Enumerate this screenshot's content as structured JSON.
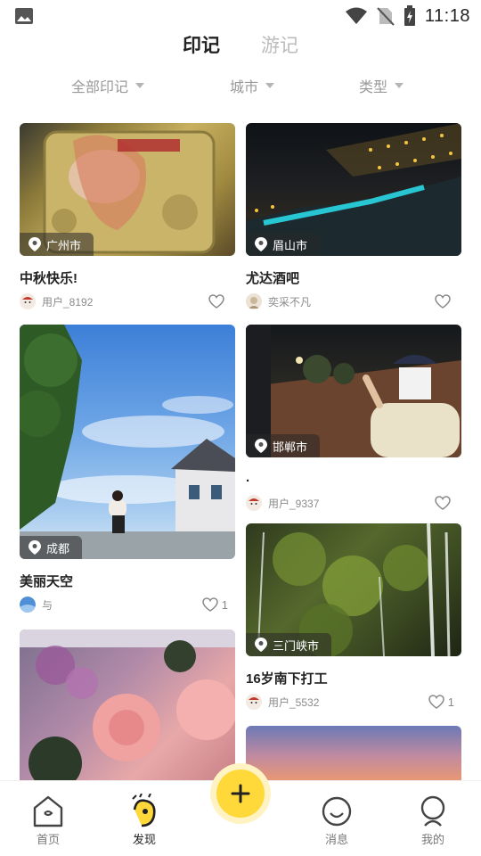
{
  "status_bar": {
    "time": "11:18"
  },
  "top_tabs": [
    {
      "label": "印记",
      "active": true
    },
    {
      "label": "游记",
      "active": false
    }
  ],
  "filters": {
    "all": "全部印记",
    "city": "城市",
    "type": "类型"
  },
  "cards": [
    {
      "location": "广州市",
      "title": "中秋快乐!",
      "user": "用户_8192",
      "likes": ""
    },
    {
      "location": "眉山市",
      "title": "尤达酒吧",
      "user": "奕采不凡",
      "likes": ""
    },
    {
      "location": "成都",
      "title": "美丽天空",
      "user": "与",
      "likes": "1"
    },
    {
      "location": "邯郸市",
      "title": ".",
      "user": "用户_9337",
      "likes": ""
    },
    {
      "location": "三门峡市",
      "title": "16岁南下打工",
      "user": "用户_5532",
      "likes": "1"
    }
  ],
  "nav": {
    "home": "首页",
    "discover": "发现",
    "messages": "消息",
    "mine": "我的"
  },
  "colors": {
    "accent": "#ffd83a",
    "fab_ring": "#fff3c4",
    "muted_text": "#999999"
  },
  "icons": [
    "gallery-icon",
    "wifi-icon",
    "no-sim-icon",
    "battery-icon",
    "location-pin-icon",
    "heart-icon",
    "plus-icon",
    "home-icon",
    "discover-icon",
    "message-icon",
    "profile-icon"
  ]
}
